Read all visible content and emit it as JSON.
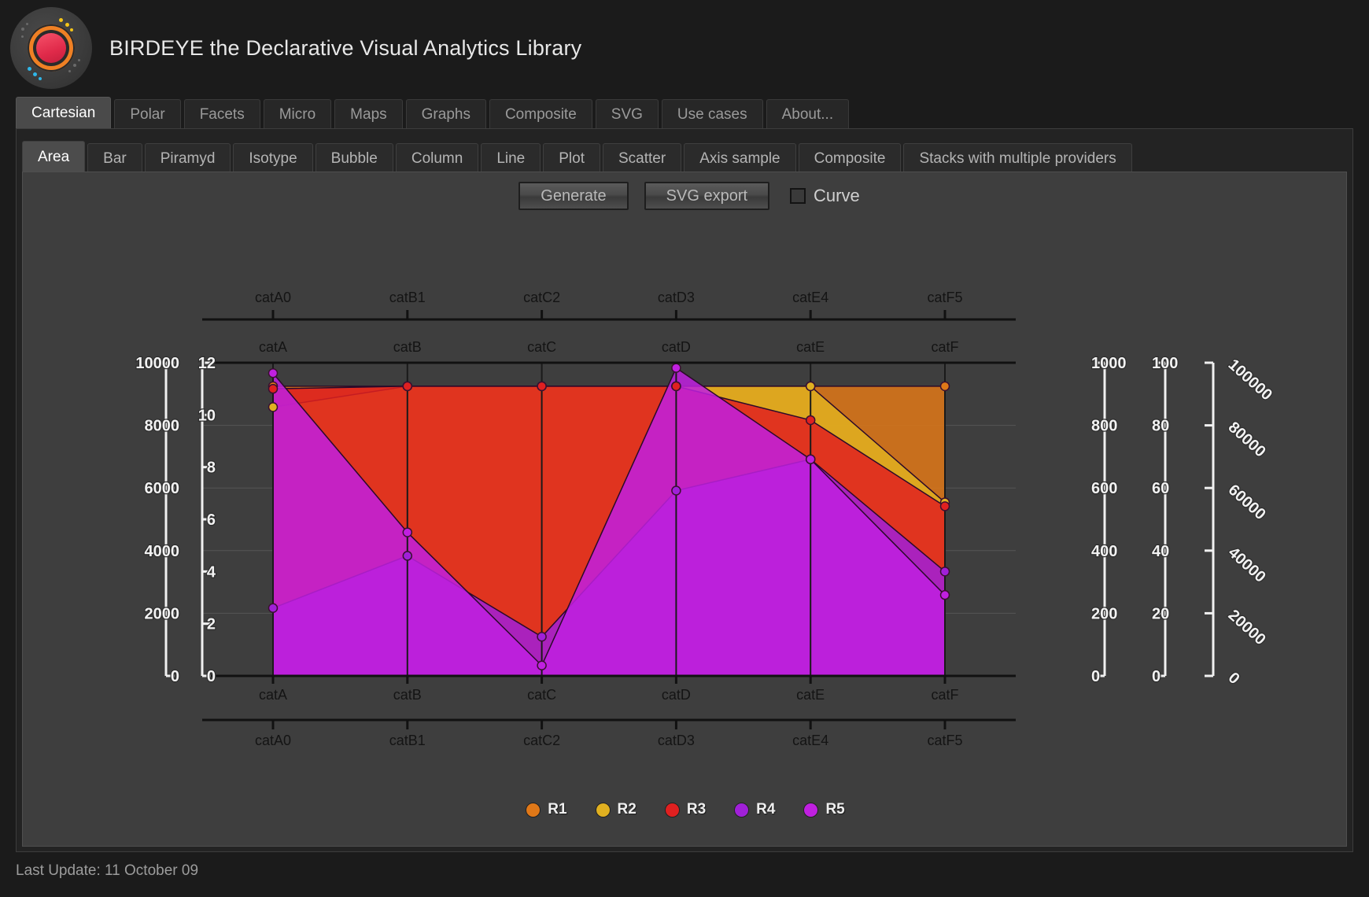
{
  "header": {
    "title": "BIRDEYE the Declarative Visual Analytics Library",
    "logo_icon": "birdeye-logo-icon"
  },
  "outer_tabs": [
    {
      "label": "Cartesian",
      "active": true
    },
    {
      "label": "Polar",
      "active": false
    },
    {
      "label": "Facets",
      "active": false
    },
    {
      "label": "Micro",
      "active": false
    },
    {
      "label": "Maps",
      "active": false
    },
    {
      "label": "Graphs",
      "active": false
    },
    {
      "label": "Composite",
      "active": false
    },
    {
      "label": "SVG",
      "active": false
    },
    {
      "label": "Use cases",
      "active": false
    },
    {
      "label": "About...",
      "active": false
    }
  ],
  "inner_tabs": [
    {
      "label": "Area",
      "active": true
    },
    {
      "label": "Bar",
      "active": false
    },
    {
      "label": "Piramyd",
      "active": false
    },
    {
      "label": "Isotype",
      "active": false
    },
    {
      "label": "Bubble",
      "active": false
    },
    {
      "label": "Column",
      "active": false
    },
    {
      "label": "Line",
      "active": false
    },
    {
      "label": "Plot",
      "active": false
    },
    {
      "label": "Scatter",
      "active": false
    },
    {
      "label": "Axis sample",
      "active": false
    },
    {
      "label": "Composite",
      "active": false
    },
    {
      "label": "Stacks with multiple providers",
      "active": false
    }
  ],
  "toolbar": {
    "generate_label": "Generate",
    "svg_export_label": "SVG export",
    "curve_label": "Curve",
    "curve_checked": false
  },
  "footer": {
    "last_update": "Last Update: 11 October 09"
  },
  "colors": {
    "R1": "#e07818",
    "R2": "#e0b020",
    "R3": "#e02020",
    "R4": "#a020d8",
    "R5": "#c020e0",
    "panel_bg": "#3e3e3e",
    "axis": "#111111",
    "axis_label": "#f2f2f2"
  },
  "chart_data": {
    "type": "area",
    "title": "",
    "xlabel": "",
    "ylabel": "",
    "grid": true,
    "legend_position": "bottom",
    "categories": [
      "catA",
      "catB",
      "catC",
      "catD",
      "catE",
      "catF"
    ],
    "categories_top": [
      "catA0",
      "catB1",
      "catC2",
      "catD3",
      "catE4",
      "catF5"
    ],
    "categories_bottom": [
      "catA0",
      "catB1",
      "catC2",
      "catD3",
      "catE4",
      "catF5"
    ],
    "legend": [
      "R1",
      "R2",
      "R3",
      "R4",
      "R5"
    ],
    "axes": [
      {
        "id": "y-left-10000",
        "side": "left",
        "ticks": [
          0,
          2000,
          4000,
          6000,
          8000,
          10000
        ],
        "min": 0,
        "max": 10000,
        "rotated": false
      },
      {
        "id": "y-left-12",
        "side": "left",
        "ticks": [
          0,
          2,
          4,
          6,
          8,
          10,
          12
        ],
        "min": 0,
        "max": 12,
        "rotated": false
      },
      {
        "id": "y-right-1000",
        "side": "right",
        "ticks": [
          0,
          200,
          400,
          600,
          800,
          1000
        ],
        "min": 0,
        "max": 1000,
        "rotated": false
      },
      {
        "id": "y-right-100",
        "side": "right",
        "ticks": [
          0,
          20,
          40,
          60,
          80,
          100
        ],
        "min": 0,
        "max": 100,
        "rotated": false
      },
      {
        "id": "y-right-100000",
        "side": "right",
        "ticks": [
          0,
          20000,
          40000,
          60000,
          80000,
          100000
        ],
        "min": 0,
        "max": 100000,
        "rotated": true
      }
    ],
    "scale_max": 12,
    "series": [
      {
        "name": "R1",
        "color": "#e07818",
        "axis": "y-left-12",
        "values": [
          11.1,
          11.1,
          11.1,
          11.1,
          11.1,
          11.1
        ]
      },
      {
        "name": "R2",
        "color": "#e0b020",
        "axis": "y-left-12",
        "values": [
          10.3,
          11.1,
          11.1,
          11.1,
          11.1,
          6.65
        ]
      },
      {
        "name": "R3",
        "color": "#e02020",
        "axis": "y-left-12",
        "values": [
          11.0,
          11.1,
          11.1,
          11.1,
          9.8,
          6.5
        ]
      },
      {
        "name": "R4",
        "color": "#a020d8",
        "axis": "y-left-12",
        "values": [
          2.6,
          4.6,
          1.5,
          7.1,
          8.3,
          4.0
        ]
      },
      {
        "name": "R5",
        "color": "#c020e0",
        "axis": "y-left-12",
        "values": [
          11.6,
          5.5,
          0.4,
          11.8,
          8.3,
          3.1
        ]
      }
    ]
  }
}
